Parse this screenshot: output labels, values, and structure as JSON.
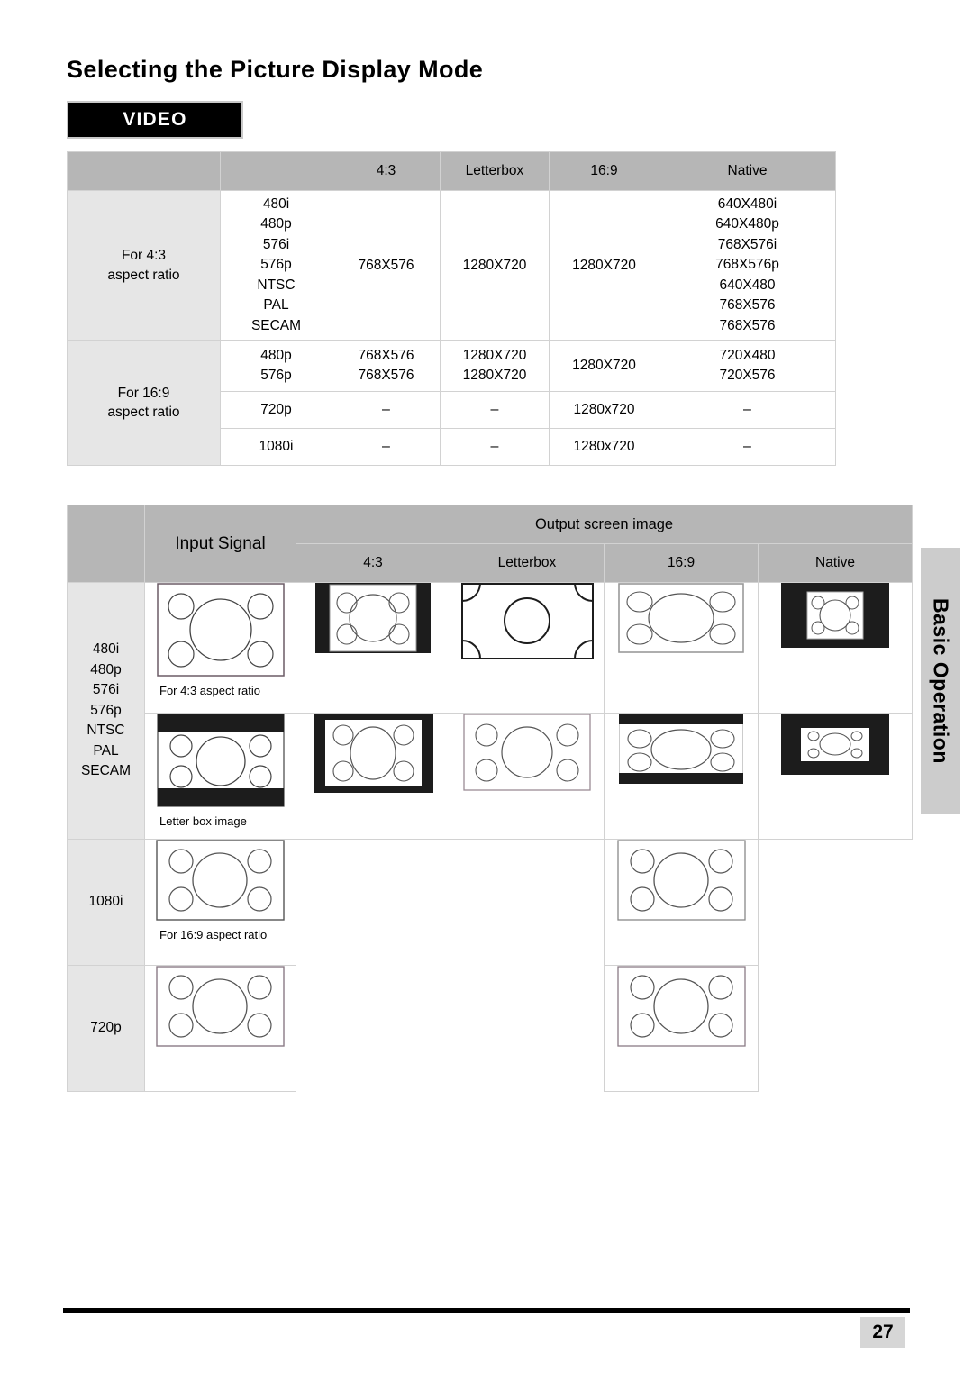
{
  "page": {
    "title": "Selecting the Picture Display Mode",
    "badge": "VIDEO",
    "side_tab": "Basic Operation",
    "page_number": "27"
  },
  "mode_table": {
    "headers": [
      "",
      "",
      "4:3",
      "Letterbox",
      "16:9",
      "Native"
    ],
    "groups": [
      {
        "label": "For 4:3\naspect ratio",
        "label_line1": "For 4:3",
        "label_line2": "aspect ratio",
        "rows": [
          {
            "signal": "480i\n480p\n576i\n576p\nNTSC\nPAL\nSECAM",
            "ratio_43": "768X576",
            "letterbox": "1280X720",
            "ratio_169": "1280X720",
            "native": "640X480i\n640X480p\n768X576i\n768X576p\n640X480\n768X576\n768X576"
          }
        ]
      },
      {
        "label_line1": "For 16:9",
        "label_line2": "aspect ratio",
        "rows": [
          {
            "signal": "480p\n576p",
            "ratio_43": "768X576\n768X576",
            "letterbox": "1280X720\n1280X720",
            "ratio_169": "1280X720",
            "native": "720X480\n720X576"
          },
          {
            "signal": "720p",
            "ratio_43": "–",
            "letterbox": "–",
            "ratio_169": "1280x720",
            "native": "–"
          },
          {
            "signal": "1080i",
            "ratio_43": "–",
            "letterbox": "–",
            "ratio_169": "1280x720",
            "native": "–"
          }
        ]
      }
    ]
  },
  "image_table": {
    "input_signal_header": "Input Signal",
    "output_group_header": "Output screen image",
    "output_headers": [
      "4:3",
      "Letterbox",
      "16:9",
      "Native"
    ],
    "rows": [
      {
        "signal_label": "480i\n480p\n576i\n576p\nNTSC\nPAL\nSECAM",
        "input_caption": "For 4:3 aspect ratio",
        "input_kind": "box-43",
        "outputs": [
          "pillarbox-43",
          "zoom-crop-169",
          "stretch-169",
          "native-small-43"
        ]
      },
      {
        "signal_label": "",
        "input_caption": "Letter box image",
        "input_kind": "letterbox-43",
        "outputs": [
          "pillarbox-letterbox",
          "fill-169",
          "letterbox-169",
          "native-small-letterbox"
        ]
      },
      {
        "signal_label": "1080i",
        "input_caption": "For 16:9 aspect ratio",
        "input_kind": "box-169",
        "outputs": [
          "",
          "",
          "fill-169-plain",
          ""
        ]
      },
      {
        "signal_label": "720p",
        "input_caption": "",
        "input_kind": "box-169",
        "outputs": [
          "",
          "",
          "fill-169-plain",
          ""
        ]
      }
    ]
  },
  "colors": {
    "header_grey": "#b6b6b6",
    "label_grey": "#e6e6e6",
    "tab_grey": "#cccccc",
    "badge_black": "#000000"
  }
}
